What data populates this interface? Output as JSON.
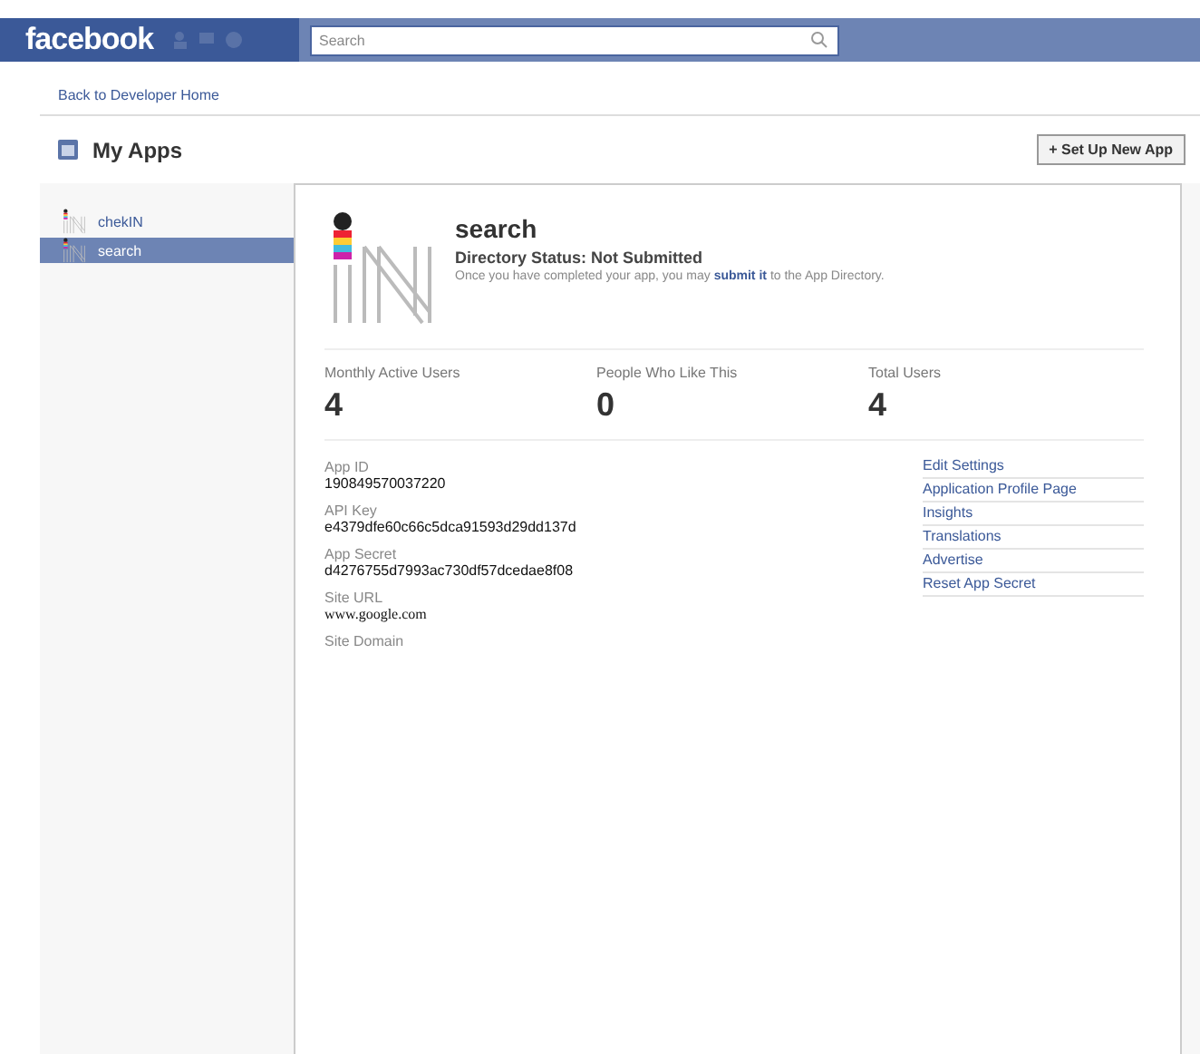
{
  "header": {
    "logo": "facebook",
    "search": {
      "placeholder": "Search"
    }
  },
  "back_link": "Back to Developer Home",
  "page_title": "My Apps",
  "new_app_button": "+ Set Up New App",
  "sidebar": {
    "items": [
      {
        "label": "chekIN",
        "selected": false
      },
      {
        "label": "search",
        "selected": true
      }
    ]
  },
  "app": {
    "name": "search",
    "directory_status": "Directory Status: Not Submitted",
    "description": {
      "before": "Once you have completed your app, you may",
      "link": "submit it",
      "after": "to the App Directory."
    },
    "stats": [
      {
        "label": "Monthly Active Users",
        "value": "4"
      },
      {
        "label": "People Who Like This",
        "value": "0"
      },
      {
        "label": "Total Users",
        "value": "4"
      }
    ],
    "fields": [
      {
        "label": "App ID",
        "value": "190849570037220"
      },
      {
        "label": "API Key",
        "value": "e4379dfe60c66c5dca91593d29dd137d"
      },
      {
        "label": "App Secret",
        "value": "d4276755d7993ac730df57dcedae8f08"
      },
      {
        "label": "Site URL",
        "value": "www.google.com"
      },
      {
        "label": "Site Domain"
      }
    ],
    "links": [
      "Edit Settings",
      "Application Profile Page",
      "Insights",
      "Translations",
      "Advertise",
      "Reset App Secret"
    ]
  }
}
